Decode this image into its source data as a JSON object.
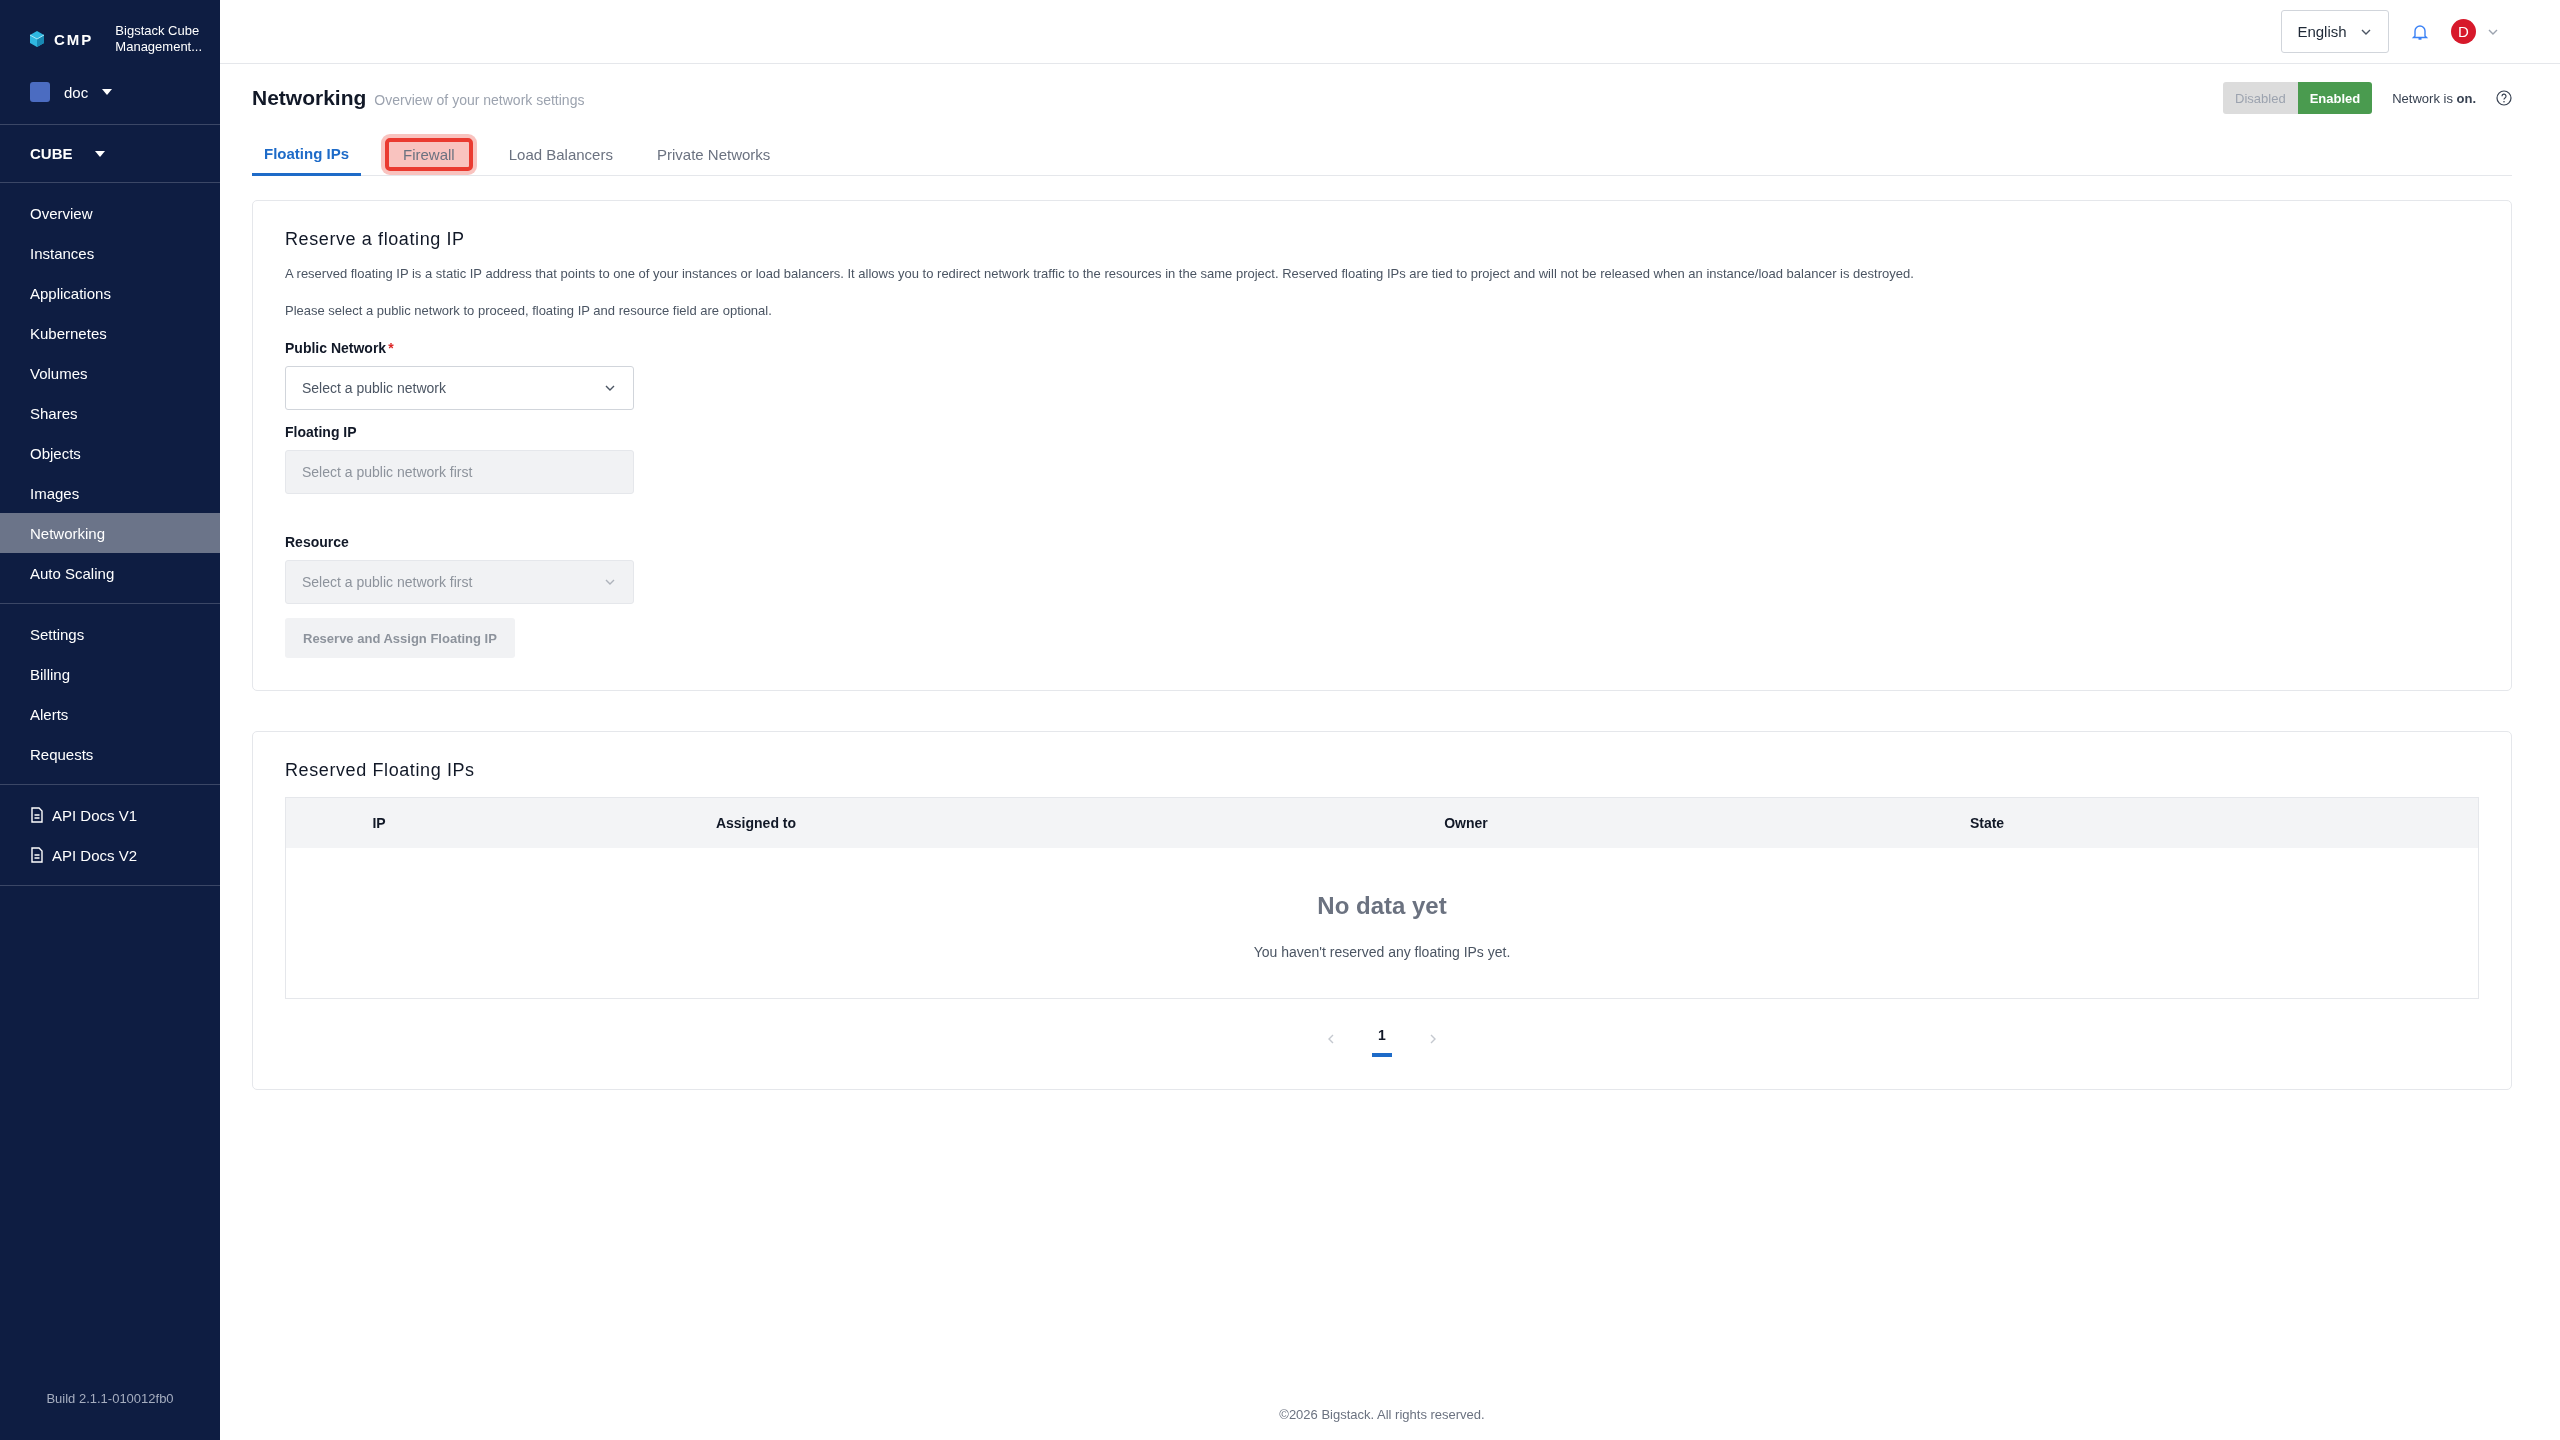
{
  "sidebar": {
    "logo_text": "CMP",
    "product_name": "Bigstack Cube\nManagement...",
    "project": {
      "name": "doc"
    },
    "region": {
      "name": "CUBE"
    },
    "nav_groups": [
      {
        "items": [
          {
            "label": "Overview",
            "selected": false
          },
          {
            "label": "Instances",
            "selected": false
          },
          {
            "label": "Applications",
            "selected": false
          },
          {
            "label": "Kubernetes",
            "selected": false
          },
          {
            "label": "Volumes",
            "selected": false
          },
          {
            "label": "Shares",
            "selected": false
          },
          {
            "label": "Objects",
            "selected": false
          },
          {
            "label": "Images",
            "selected": false
          },
          {
            "label": "Networking",
            "selected": true
          },
          {
            "label": "Auto Scaling",
            "selected": false
          }
        ]
      },
      {
        "items": [
          {
            "label": "Settings",
            "selected": false
          },
          {
            "label": "Billing",
            "selected": false
          },
          {
            "label": "Alerts",
            "selected": false
          },
          {
            "label": "Requests",
            "selected": false
          }
        ]
      }
    ],
    "docs": [
      {
        "label": "API Docs V1"
      },
      {
        "label": "API Docs V2"
      }
    ],
    "build": "Build 2.1.1-010012fb0"
  },
  "header": {
    "language": "English",
    "avatar_letter": "D"
  },
  "page": {
    "title": "Networking",
    "subtitle": "Overview of your network settings",
    "network_toggle": [
      {
        "label": "Disabled",
        "selected": false
      },
      {
        "label": "Enabled",
        "selected": true
      }
    ],
    "network_status": "Network is **on.**",
    "tabs": [
      {
        "label": "Floating IPs",
        "selected": true,
        "highlighted": false
      },
      {
        "label": "Firewall",
        "selected": false,
        "highlighted": true
      },
      {
        "label": "Load Balancers",
        "selected": false,
        "highlighted": false
      },
      {
        "label": "Private Networks",
        "selected": false,
        "highlighted": false
      }
    ]
  },
  "reserve_card": {
    "title": "Reserve a floating IP",
    "paragraphs": [
      "A reserved floating IP is a static IP address that points to one of your instances or load balancers. It allows you to redirect network traffic to the resources in the same project. Reserved floating IPs are tied to project and will not be released when an instance/load balancer is destroyed.",
      "Please select a public network to proceed, floating IP and resource field are optional."
    ],
    "fields": [
      {
        "kind": "select",
        "label": "Public Network",
        "required_mark": "*",
        "placeholder": "Select a public network",
        "disabled": false
      },
      {
        "kind": "input",
        "label": "Floating IP",
        "placeholder": "Select a public network first",
        "disabled": true
      },
      {
        "kind": "select",
        "label": "Resource",
        "placeholder": "Select a public network first",
        "disabled": true
      }
    ],
    "submit": {
      "label": "Reserve and Assign Floating IP",
      "disabled": true
    }
  },
  "reserved_card": {
    "title": "Reserved Floating IPs",
    "table": {
      "columns": [
        "IP",
        "Assigned to",
        "Owner",
        "State"
      ],
      "empty_title": "No data yet",
      "empty_text": "You haven't reserved any floating IPs yet."
    },
    "pagination": {
      "pages": [
        {
          "label": "1",
          "selected": true
        }
      ]
    }
  },
  "footer": "©2026 Bigstack. All rights reserved."
}
